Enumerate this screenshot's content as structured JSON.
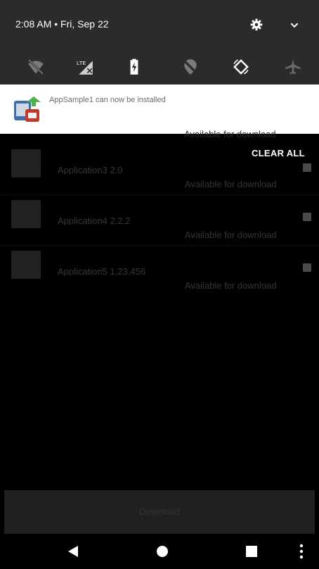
{
  "status_bar": {
    "time_date": "2:08 AM • Fri, Sep 22"
  },
  "quick_settings": {
    "tiles": [
      {
        "icon": "wifi-off-icon"
      },
      {
        "icon": "signal-lte-icon",
        "label": "LTE"
      },
      {
        "icon": "battery-charging-icon"
      },
      {
        "icon": "location-off-icon"
      },
      {
        "icon": "auto-rotate-icon"
      },
      {
        "icon": "airplane-mode-icon"
      }
    ]
  },
  "notification": {
    "text": "AppSample1 can now be installed"
  },
  "list": {
    "ghost_text": "Available for download",
    "clear_all": "CLEAR ALL",
    "items": [
      {
        "name": "Application3 2.0",
        "status": "Available for download"
      },
      {
        "name": "Application4 2.2.2",
        "status": "Available for download"
      },
      {
        "name": "Application5 1.23.456",
        "status": "Available for download"
      }
    ]
  },
  "download_button": {
    "label": "Download"
  },
  "nav_bar": {
    "icons": [
      "back-icon",
      "home-icon",
      "recents-icon",
      "more-icon"
    ]
  },
  "colors": {
    "shade_bg": "#2b2b2b",
    "notification_bg": "#ffffff",
    "screen_bg": "#000000"
  }
}
